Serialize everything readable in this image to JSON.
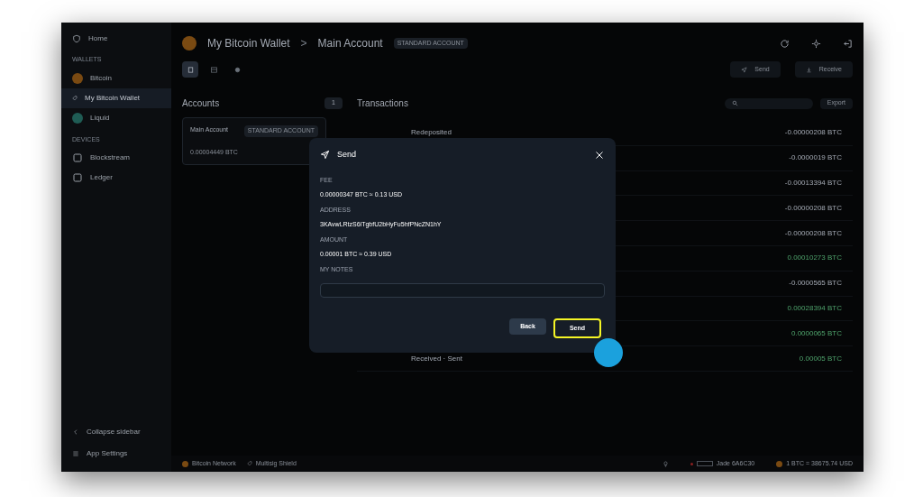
{
  "sidebar": {
    "home": "Home",
    "sections": [
      {
        "title": "WALLETS",
        "items": [
          {
            "label": "Bitcoin",
            "kind": "network",
            "color": "#7a4a12",
            "selected": false,
            "children": [
              {
                "label": "My Bitcoin Wallet",
                "selected": true
              }
            ]
          },
          {
            "label": "Liquid",
            "kind": "network",
            "color": "#1f5c54",
            "selected": false
          }
        ]
      },
      {
        "title": "DEVICES",
        "items": [
          {
            "label": "Blockstream",
            "kind": "device",
            "selected": false
          },
          {
            "label": "Ledger",
            "kind": "device",
            "selected": false
          }
        ]
      }
    ],
    "footer": [
      "Collapse sidebar",
      "App Settings"
    ]
  },
  "header": {
    "wallet": "My Bitcoin Wallet",
    "separator": ">",
    "account": "Main Account",
    "badge": "STANDARD ACCOUNT"
  },
  "view_tabs": [
    {
      "selected": true
    },
    {
      "selected": false
    },
    {
      "selected": false
    }
  ],
  "actions": [
    "Send",
    "Receive"
  ],
  "accounts": {
    "title": "Accounts",
    "count": "1",
    "items": [
      {
        "name": "Main Account",
        "badge": "STANDARD ACCOUNT",
        "balance": "0.00004449 BTC"
      }
    ]
  },
  "transactions": {
    "title": "Transactions",
    "export": "Export",
    "rows": [
      {
        "description": "Redeposited",
        "amount": "-0.00000208 BTC",
        "incoming": false
      },
      {
        "amount": "-0.0000019 BTC",
        "incoming": false
      },
      {
        "amount": "-0.00013394 BTC",
        "incoming": false
      },
      {
        "amount": "-0.00000208 BTC",
        "incoming": false
      },
      {
        "amount": "-0.00000208 BTC",
        "incoming": false
      },
      {
        "amount": "0.00010273 BTC",
        "incoming": true
      },
      {
        "amount": "-0.0000565 BTC",
        "incoming": false
      },
      {
        "amount": "0.00028394 BTC",
        "incoming": true
      },
      {
        "amount": "0.0000065 BTC",
        "incoming": true
      },
      {
        "description": "Received · Sent",
        "amount": "0.00005 BTC",
        "incoming": true
      }
    ]
  },
  "status_bar": {
    "network": "Bitcoin Network",
    "policy": "Multisig Shield",
    "device": "Jade 6A6C30",
    "rate": "1 BTC = 38675.74 USD"
  },
  "dialog": {
    "title": "Send",
    "fields": [
      {
        "label": "FEE",
        "value": "0.00000347 BTC ≈ 0.13 USD"
      },
      {
        "label": "ADDRESS",
        "value": "3KAvwLRtzS6iTgbfU2bHyFu5hfPNcZN1hY"
      },
      {
        "label": "AMOUNT",
        "value": "0.00001 BTC ≈ 0.39 USD"
      }
    ],
    "notes_label": "MY NOTES",
    "buttons": [
      {
        "label": "Back",
        "kind": "secondary",
        "highlighted": false
      },
      {
        "label": "Send",
        "kind": "primary",
        "highlighted": true
      }
    ],
    "click_marker": true
  }
}
